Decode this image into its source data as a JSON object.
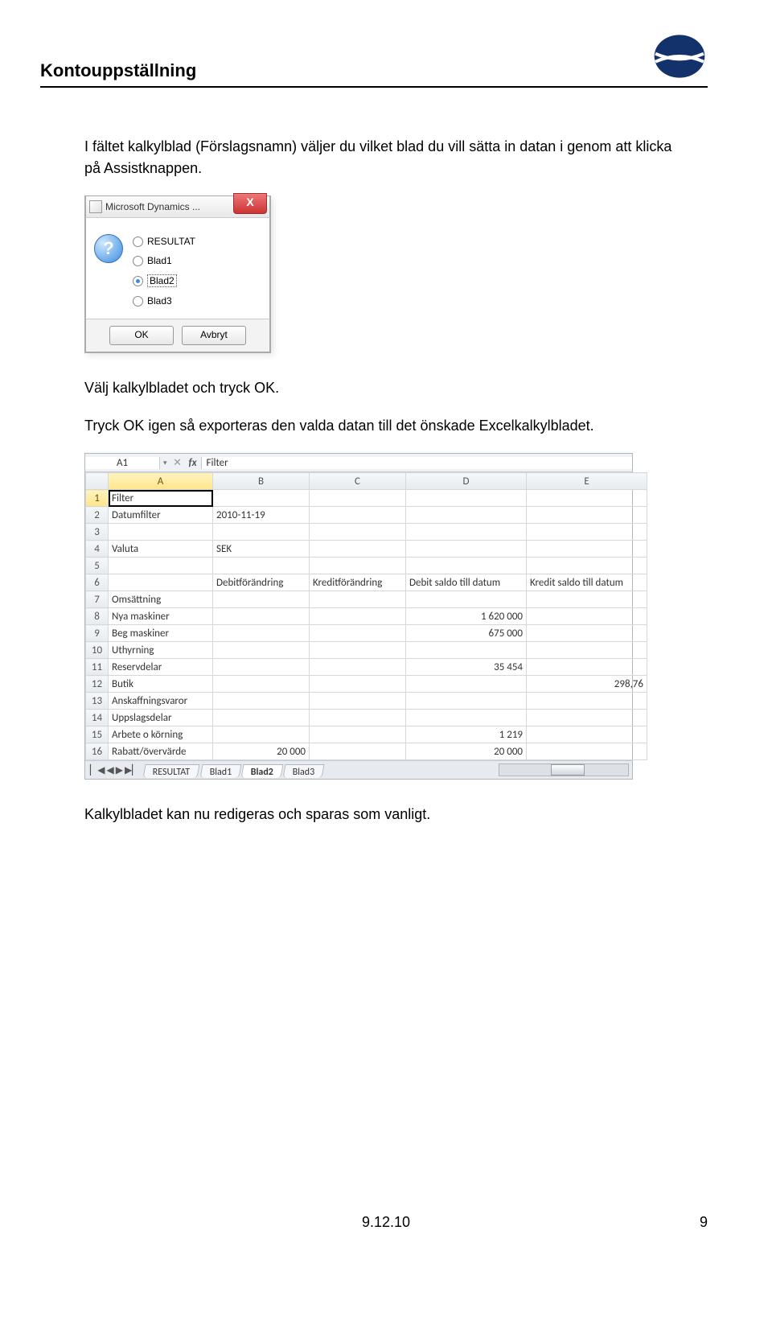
{
  "header": {
    "title": "Kontouppställning"
  },
  "paragraphs": {
    "p1": "I fältet kalkylblad (Förslagsnamn) väljer du vilket blad du vill sätta in datan i genom att klicka på Assistknappen.",
    "p2": "Välj kalkylbladet och tryck OK.",
    "p3": "Tryck OK igen så exporteras den valda datan till det önskade Excelkalkylbladet.",
    "p4": "Kalkylbladet kan nu redigeras och sparas som vanligt."
  },
  "dialog": {
    "title": "Microsoft Dynamics ...",
    "help_glyph": "?",
    "close_glyph": "X",
    "options": [
      {
        "label": "RESULTAT",
        "selected": false
      },
      {
        "label": "Blad1",
        "selected": false
      },
      {
        "label": "Blad2",
        "selected": true
      },
      {
        "label": "Blad3",
        "selected": false
      }
    ],
    "ok": "OK",
    "cancel": "Avbryt"
  },
  "spreadsheet": {
    "namebox": "A1",
    "fx_label": "fx",
    "formula": "Filter",
    "cols": [
      "A",
      "B",
      "C",
      "D",
      "E"
    ],
    "active_col": "A",
    "active_row": 1,
    "rows": [
      {
        "n": 1,
        "A": "Filter",
        "B": "",
        "C": "",
        "D": "",
        "E": ""
      },
      {
        "n": 2,
        "A": "Datumfilter",
        "B": "2010-11-19",
        "C": "",
        "D": "",
        "E": ""
      },
      {
        "n": 3,
        "A": "",
        "B": "",
        "C": "",
        "D": "",
        "E": ""
      },
      {
        "n": 4,
        "A": "Valuta",
        "B": "SEK",
        "C": "",
        "D": "",
        "E": ""
      },
      {
        "n": 5,
        "A": "",
        "B": "",
        "C": "",
        "D": "",
        "E": ""
      },
      {
        "n": 6,
        "A": "",
        "B": "Debitförändring",
        "C": "Kreditförändring",
        "D": "Debit saldo till datum",
        "E": "Kredit saldo till datum"
      },
      {
        "n": 7,
        "A": "Omsättning",
        "B": "",
        "C": "",
        "D": "",
        "E": ""
      },
      {
        "n": 8,
        "A": "Nya maskiner",
        "B": "",
        "C": "",
        "D": "1 620 000",
        "E": ""
      },
      {
        "n": 9,
        "A": "Beg maskiner",
        "B": "",
        "C": "",
        "D": "675 000",
        "E": ""
      },
      {
        "n": 10,
        "A": "Uthyrning",
        "B": "",
        "C": "",
        "D": "",
        "E": ""
      },
      {
        "n": 11,
        "A": "Reservdelar",
        "B": "",
        "C": "",
        "D": "35 454",
        "E": ""
      },
      {
        "n": 12,
        "A": "Butik",
        "B": "",
        "C": "",
        "D": "",
        "E": "298,76"
      },
      {
        "n": 13,
        "A": "Anskaffningsvaror",
        "B": "",
        "C": "",
        "D": "",
        "E": ""
      },
      {
        "n": 14,
        "A": "Uppslagsdelar",
        "B": "",
        "C": "",
        "D": "",
        "E": ""
      },
      {
        "n": 15,
        "A": "Arbete o körning",
        "B": "",
        "C": "",
        "D": "1 219",
        "E": ""
      },
      {
        "n": 16,
        "A": "Rabatt/övervärde",
        "B": "20 000",
        "C": "",
        "D": "20 000",
        "E": ""
      }
    ],
    "tabs": [
      {
        "label": "RESULTAT",
        "active": false
      },
      {
        "label": "Blad1",
        "active": false
      },
      {
        "label": "Blad2",
        "active": true
      },
      {
        "label": "Blad3",
        "active": false
      }
    ],
    "nav_glyphs": {
      "first": "▏◀",
      "prev": "◀",
      "next": "▶",
      "last": "▶▏"
    }
  },
  "footer": {
    "date": "9.12.10",
    "page": "9"
  }
}
